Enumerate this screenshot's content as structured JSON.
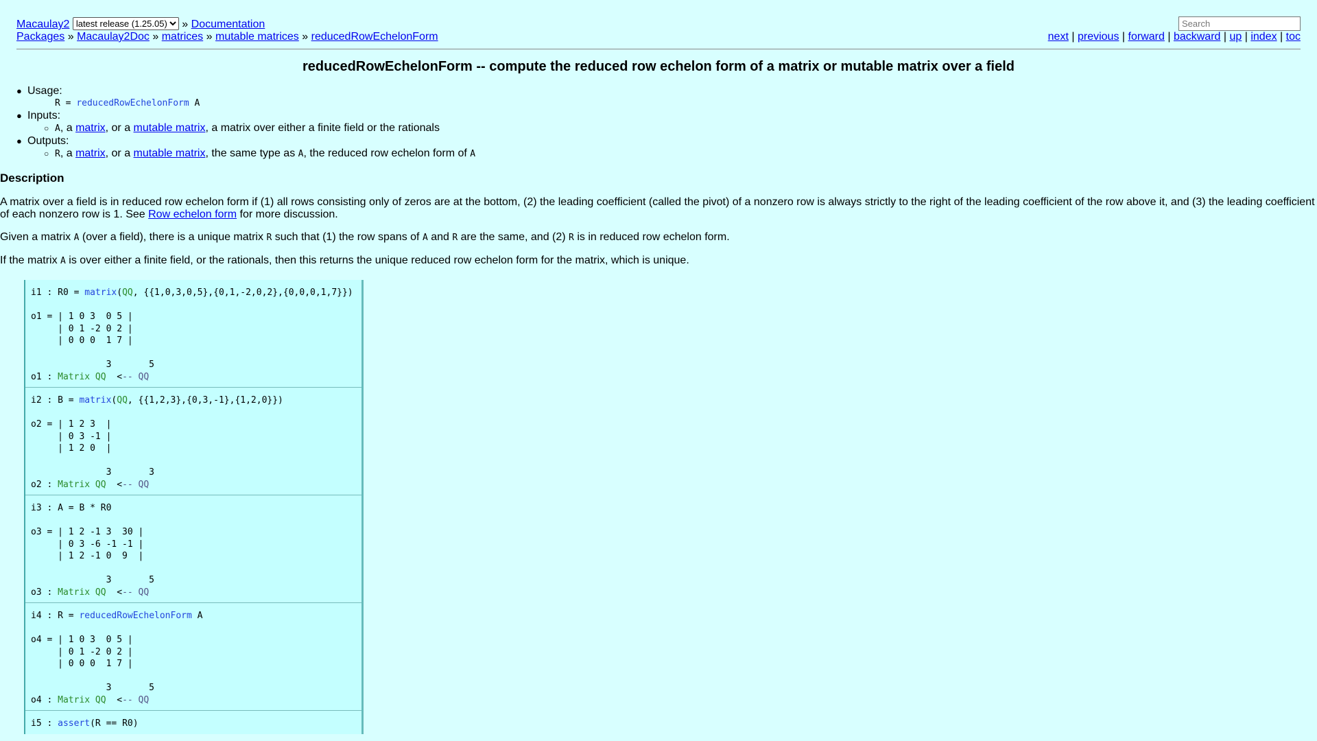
{
  "header": {
    "home_link": "Macaulay2",
    "release_select": "latest release (1.25.05)",
    "sep": "»",
    "docs_link": "Documentation",
    "search_placeholder": "Search",
    "breadcrumb": [
      "Packages",
      "Macaulay2Doc",
      "matrices",
      "mutable matrices",
      "reducedRowEchelonForm"
    ],
    "nav": [
      "next",
      "previous",
      "forward",
      "backward",
      "up",
      "index",
      "toc"
    ],
    "nav_sep": "|"
  },
  "title": "reducedRowEchelonForm -- compute the reduced row echelon form of a matrix or mutable matrix over a field",
  "usage": {
    "usage_label": "Usage:",
    "usage_lhs": "R = ",
    "usage_fn": "reducedRowEchelonForm",
    "usage_arg": " A",
    "inputs_label": "Inputs:",
    "input_var": "A",
    "input_a": ", a ",
    "input_link1": "matrix",
    "input_or": ", or a ",
    "input_link2": "mutable matrix",
    "input_desc": ", a matrix over either a finite field or the rationals",
    "outputs_label": "Outputs:",
    "output_var": "R",
    "output_a": ", a ",
    "output_link1": "matrix",
    "output_or": ", or a ",
    "output_link2": "mutable matrix",
    "output_desc1": ", the same type as ",
    "output_var2": "A",
    "output_desc2": ", the reduced row echelon form of ",
    "output_var3": "A"
  },
  "description": {
    "heading": "Description",
    "p1_text": "A matrix over a field is in reduced row echelon form if (1) all rows consisting only of zeros are at the bottom, (2) the leading coefficient (called the pivot) of a nonzero row is always strictly to the right of the leading coefficient of the row above it, and (3) the leading coefficient of each nonzero row is 1. See ",
    "p1_link": "Row echelon form",
    "p1_end": " for more discussion.",
    "p2_a": "Given a matrix ",
    "p2_A": "A",
    "p2_b": " (over a field), there is a unique matrix ",
    "p2_R": "R",
    "p2_c": " such that (1) the row spans of ",
    "p2_A2": "A",
    "p2_d": " and ",
    "p2_R2": "R",
    "p2_e": " are the same, and (2) ",
    "p2_R3": "R",
    "p2_f": " is in reduced row echelon form.",
    "p3_a": "If the matrix ",
    "p3_A": "A",
    "p3_b": " is over either a finite field, or the rationals, then this returns the unique reduced row echelon form for the matrix, which is unique."
  },
  "examples": [
    {
      "in_prefix": "i1 : R0 = ",
      "in_fn": "matrix",
      "in_paren": "(",
      "in_ring": "QQ",
      "in_rest": ", {{1,0,3,0,5},{0,1,-2,0,2},{0,0,0,1,7}})",
      "out": "\no1 = | 1 0 3  0 5 |\n     | 0 1 -2 0 2 |\n     | 0 0 0  1 7 |\n\n              3       5\n",
      "type_prefix": "o1 : ",
      "type_name": "Matrix QQ",
      "type_arrow": "  <",
      "type_rest": "-- QQ"
    },
    {
      "in_prefix": "i2 : B = ",
      "in_fn": "matrix",
      "in_paren": "(",
      "in_ring": "QQ",
      "in_rest": ", {{1,2,3},{0,3,-1},{1,2,0}})",
      "out": "\no2 = | 1 2 3  |\n     | 0 3 -1 |\n     | 1 2 0  |\n\n              3       3\n",
      "type_prefix": "o2 : ",
      "type_name": "Matrix QQ",
      "type_arrow": "  <",
      "type_rest": "-- QQ"
    },
    {
      "in_prefix": "i3 : A = B * R0",
      "in_fn": "",
      "in_paren": "",
      "in_ring": "",
      "in_rest": "",
      "out": "\no3 = | 1 2 -1 3  30 |\n     | 0 3 -6 -1 -1 |\n     | 1 2 -1 0  9  |\n\n              3       5\n",
      "type_prefix": "o3 : ",
      "type_name": "Matrix QQ",
      "type_arrow": "  <",
      "type_rest": "-- QQ"
    },
    {
      "in_prefix": "i4 : R = ",
      "in_fn": "reducedRowEchelonForm",
      "in_paren": "",
      "in_ring": "",
      "in_rest": " A",
      "out": "\no4 = | 1 0 3  0 5 |\n     | 0 1 -2 0 2 |\n     | 0 0 0  1 7 |\n\n              3       5\n",
      "type_prefix": "o4 : ",
      "type_name": "Matrix QQ",
      "type_arrow": "  <",
      "type_rest": "-- QQ"
    },
    {
      "in_prefix": "i5 : ",
      "in_fn": "assert",
      "in_paren": "",
      "in_ring": "",
      "in_rest": "(R == R0)",
      "out": "",
      "type_prefix": "",
      "type_name": "",
      "type_arrow": "",
      "type_rest": ""
    }
  ]
}
